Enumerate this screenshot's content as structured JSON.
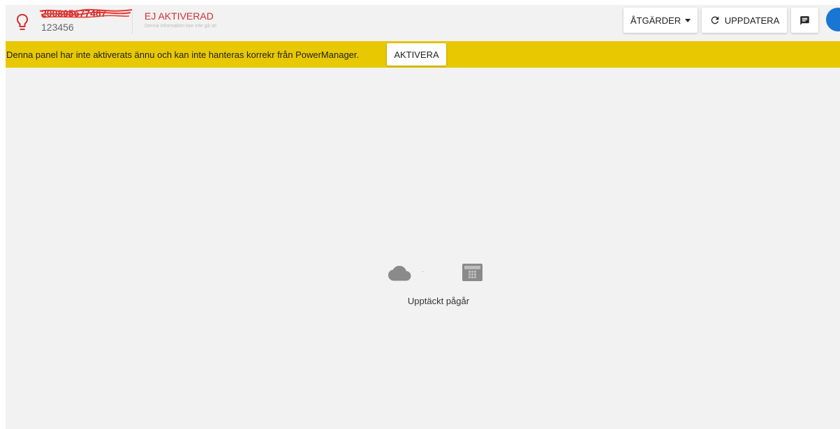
{
  "header": {
    "serial_number": "200895677467",
    "code": "123456",
    "status_title": "EJ AKTIVERAD",
    "status_subtitle": "Denna information kan inte gå ut!",
    "actions_label": "ÅTGÄRDER",
    "refresh_label": "UPPDATERA"
  },
  "banner": {
    "message": "Denna panel har inte aktiverats ännu och kan inte hanteras korrekr från PowerManager.",
    "activate_label": "AKTIVERA"
  },
  "main": {
    "discovery_text": "Upptäckt pågår"
  },
  "icons": {
    "status": "lightbulb-icon",
    "actions": "caret-down-icon",
    "refresh": "refresh-icon",
    "chat": "message-icon",
    "cloud": "cloud-icon",
    "panel": "alarm-panel-icon"
  },
  "colors": {
    "status_red": "#d32f2f",
    "banner_yellow": "#e8c800",
    "accent_blue": "#1976d2",
    "icon_gray": "#8a8a8a"
  }
}
